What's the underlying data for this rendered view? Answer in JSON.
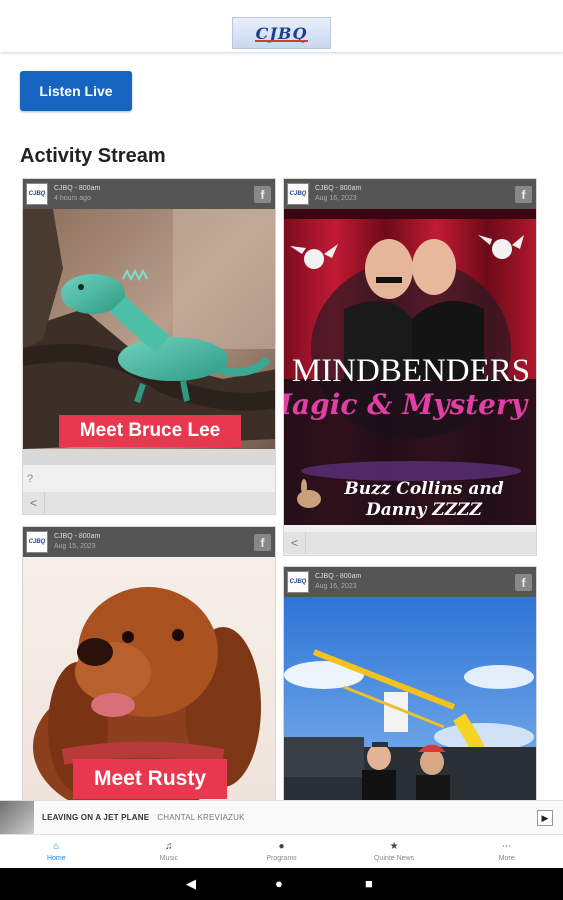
{
  "header": {
    "logo_text": "CJBQ"
  },
  "listen_button": {
    "label": "Listen Live"
  },
  "activity": {
    "title": "Activity Stream"
  },
  "cards": [
    {
      "source": "CJBQ - 800am",
      "time": "4 hours ago",
      "overlay": "Meet Bruce Lee",
      "caption": "?"
    },
    {
      "source": "CJBQ - 800am",
      "time": "Aug 16, 2023",
      "poster_title": "MINDBENDERS",
      "poster_sub": "Magic & Mystery",
      "poster_names_1": "Buzz Collins and",
      "poster_names_2": "Danny ZZZZ"
    },
    {
      "source": "CJBQ - 800am",
      "time": "Aug 15, 2023",
      "overlay": "Meet Rusty"
    },
    {
      "source": "CJBQ - 800am",
      "time": "Aug 16, 2023"
    }
  ],
  "now_playing": {
    "track": "LEAVING ON A JET PLANE",
    "artist": "CHANTAL KREVIAZUK"
  },
  "bottom_nav": [
    {
      "label": "Home",
      "icon": "home-icon",
      "glyph": "⌂"
    },
    {
      "label": "Music",
      "icon": "music-note-icon",
      "glyph": "♫"
    },
    {
      "label": "Programs",
      "icon": "microphone-icon",
      "glyph": "🎙"
    },
    {
      "label": "Quinte News",
      "icon": "star-icon",
      "glyph": "★"
    },
    {
      "label": "More",
      "icon": "more-icon",
      "glyph": "⋯"
    }
  ],
  "colors": {
    "accent": "#1565c0",
    "nav_active": "#1e88e5",
    "label_red": "#e8384f"
  }
}
